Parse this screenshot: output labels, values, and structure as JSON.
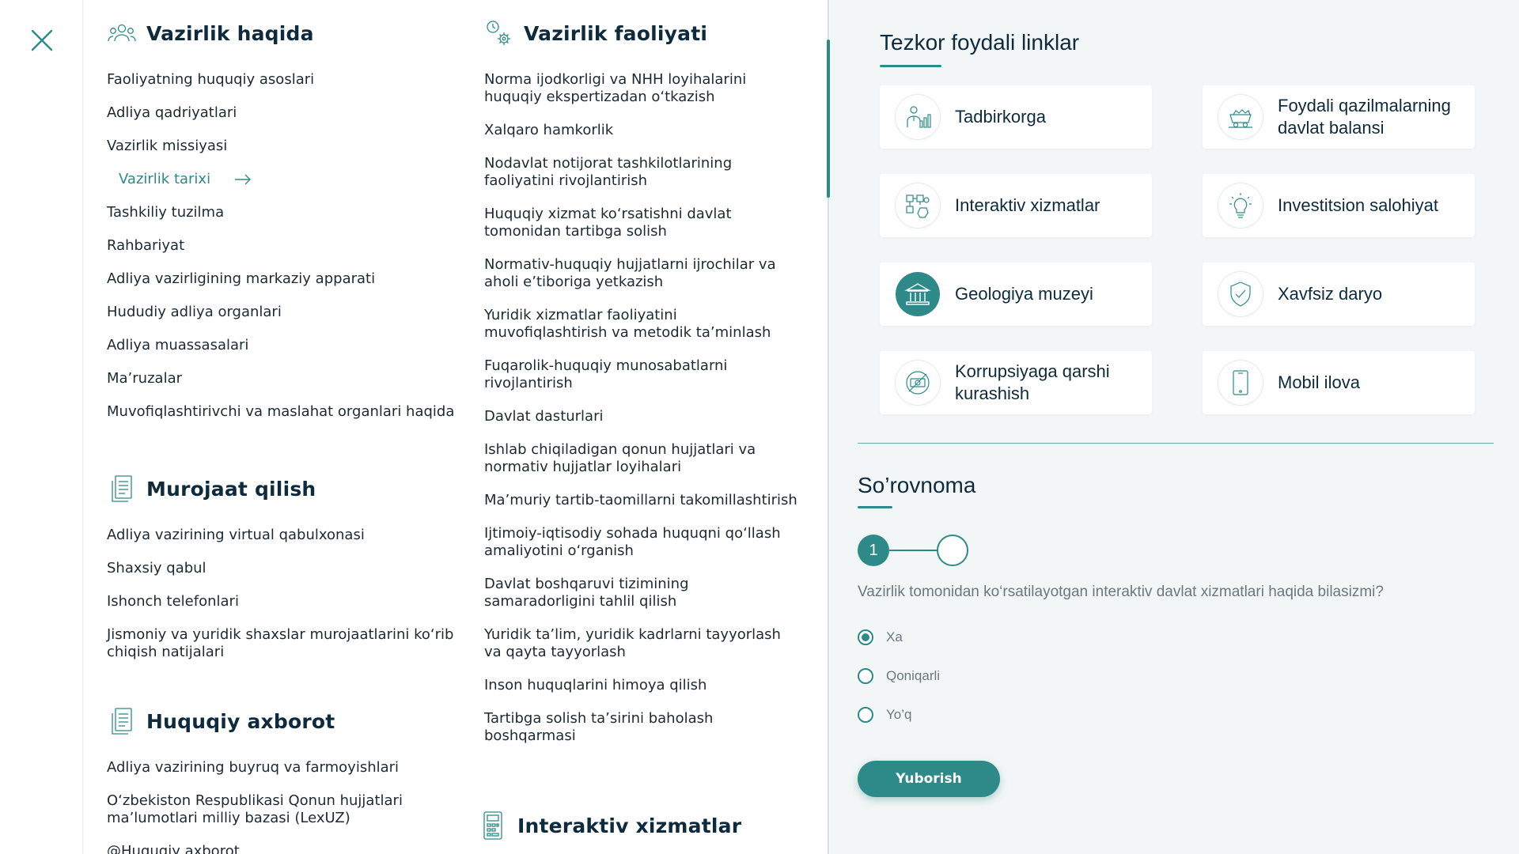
{
  "icons": {
    "close": "close-icon",
    "arrow": "arrow-right-icon"
  },
  "colors": {
    "accent": "#2d8a88",
    "heading": "#0e2a3d",
    "text": "#1d2a33",
    "muted": "#6a7880",
    "panel_bg": "#f3f6f6"
  },
  "col1": {
    "about": {
      "title": "Vazirlik haqida",
      "items": [
        "Faoliyatning huquqiy asoslari",
        "Adliya qadriyatlari",
        "Vazirlik missiyasi",
        "Vazirlik tarixi",
        "Tashkiliy tuzilma",
        "Rahbariyat",
        "Adliya vazirligining markaziy apparati",
        "Hududiy adliya organlari",
        "Adliya muassasalari",
        "Ma’ruzalar",
        "Muvofiqlashtirivchi va maslahat organlari haqida"
      ],
      "active_index": 3
    },
    "appeal": {
      "title": "Murojaat qilish",
      "items": [
        "Adliya vazirining virtual qabulxonasi",
        "Shaxsiy qabul",
        "Ishonch telefonlari",
        "Jismoniy va yuridik shaxslar murojaatlarini ko‘rib chiqish natijalari"
      ]
    },
    "legal": {
      "title": "Huquqiy axborot",
      "items": [
        "Adliya vazirining buyruq va farmoyishlari",
        "O‘zbekiston Respublikasi Qonun hujjatlari ma’lumotlari milliy bazasi (LexUZ)",
        "@Huquqiy axborot"
      ]
    }
  },
  "col2": {
    "activity": {
      "title": "Vazirlik faoliyati",
      "items": [
        "Norma ijodkorligi va NHH loyihalarini huquqiy ekspertizadan o‘tkazish",
        "Xalqaro hamkorlik",
        "Nodavlat notijorat tashkilotlarining faoliyatini rivojlantirish",
        "Huquqiy xizmat ko‘rsatishni davlat tomonidan tartibga solish",
        "Normativ-huquqiy hujjatlarni ijrochilar va aholi e’tiboriga yetkazish",
        "Yuridik xizmatlar faoliyatini muvofiqlashtirish va metodik ta’minlash",
        "Fuqarolik-huquqiy munosabatlarni rivojlantirish",
        "Davlat dasturlari",
        "Ishlab chiqiladigan qonun hujjatlari va normativ hujjatlar loyihalari",
        "Ma’muriy tartib-taomillarni takomillashtirish",
        "Ijtimoiy-iqtisodiy sohada huquqni qo‘llash amaliyotini o‘rganish",
        "Davlat boshqaruvi tizimining samaradorligini tahlil qilish",
        "Yuridik ta’lim, yuridik kadrlarni tayyorlash va qayta tayyorlash",
        "Inson huquqlarini himoya qilish",
        "Tartibga solish ta’sirini baholash boshqarmasi"
      ]
    },
    "interactive": {
      "title": "Interaktiv xizmatlar"
    }
  },
  "quick_links": {
    "title": "Tezkor foydali linklar",
    "cards": [
      {
        "label": "Tadbirkorga",
        "icon": "businessman-chart-icon"
      },
      {
        "label": "Foydali qazilmalarning davlat balansi",
        "icon": "mine-cart-icon"
      },
      {
        "label": "Interaktiv xizmatlar",
        "icon": "interactive-services-icon"
      },
      {
        "label": "Investitsion salohiyat",
        "icon": "lightbulb-icon"
      },
      {
        "label": "Geologiya muzeyi",
        "icon": "museum-icon"
      },
      {
        "label": "Xavfsiz daryo",
        "icon": "shield-check-icon"
      },
      {
        "label": "Korrupsiyaga qarshi kurashish",
        "icon": "anti-corruption-icon"
      },
      {
        "label": "Mobil ilova",
        "icon": "mobile-phone-icon"
      }
    ]
  },
  "survey": {
    "title": "So’rovnoma",
    "step_current": "1",
    "question": "Vazirlik tomonidan ko‘rsatilayotgan interaktiv davlat xizmatlari haqida bilasizmi?",
    "options": [
      "Xa",
      "Qoniqarli",
      "Yo’q"
    ],
    "selected_index": 0,
    "submit_label": "Yuborish"
  }
}
